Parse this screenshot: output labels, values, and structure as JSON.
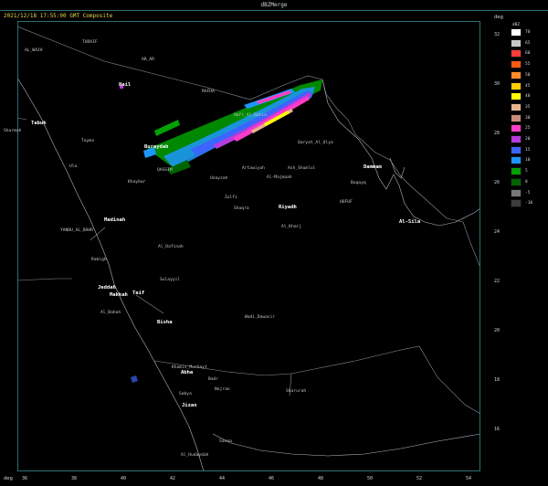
{
  "window": {
    "title": "dBZMerge"
  },
  "product": {
    "timestamp": "2021/12/18 17:55:00 GMT Composite"
  },
  "axis": {
    "corner_label": "deg",
    "right_label": "deg"
  },
  "lat_ticks": [
    "32",
    "30",
    "28",
    "26",
    "24",
    "22",
    "20",
    "18",
    "16"
  ],
  "lon_ticks": [
    "36",
    "38",
    "40",
    "42",
    "44",
    "46",
    "48",
    "50",
    "52",
    "54"
  ],
  "scale": {
    "unit": "dBZ",
    "entries": [
      {
        "label": "70",
        "color": "#ffffff"
      },
      {
        "label": "65",
        "color": "#c8c8c8"
      },
      {
        "label": "60",
        "color": "#ff3c3c"
      },
      {
        "label": "55",
        "color": "#ff5a14"
      },
      {
        "label": "50",
        "color": "#ff8c28"
      },
      {
        "label": "45",
        "color": "#ffcc00"
      },
      {
        "label": "40",
        "color": "#ffff00"
      },
      {
        "label": "35",
        "color": "#e6b48c"
      },
      {
        "label": "30",
        "color": "#c88c78"
      },
      {
        "label": "25",
        "color": "#ff3cc8"
      },
      {
        "label": "20",
        "color": "#b43cdc"
      },
      {
        "label": "15",
        "color": "#3c64ff"
      },
      {
        "label": "10",
        "color": "#1e96ff"
      },
      {
        "label": "5",
        "color": "#00a000"
      },
      {
        "label": "0",
        "color": "#006400"
      },
      {
        "label": "-5",
        "color": "#787878"
      },
      {
        "label": "-10",
        "color": "#3c3c3c"
      }
    ]
  },
  "colors": {
    "frame": "#2e6f74",
    "borders": "#8a949c",
    "timestamp": "#e6d44a"
  },
  "cities": [
    {
      "name": "AL_WAJH",
      "major": false
    },
    {
      "name": "TURAIF",
      "major": false
    },
    {
      "name": "AR_AR",
      "major": false
    },
    {
      "name": "RAFHA",
      "major": false
    },
    {
      "name": "Tabuk",
      "major": true
    },
    {
      "name": "Hail",
      "major": true
    },
    {
      "name": "Buraydah",
      "major": true
    },
    {
      "name": "Unayzah",
      "major": false
    },
    {
      "name": "Al-Majmaah",
      "major": false
    },
    {
      "name": "QASSIM",
      "major": false
    },
    {
      "name": "Artawiyah",
      "major": false
    },
    {
      "name": "Hafr_Al_Batin",
      "major": false
    },
    {
      "name": "Qaryat_Al_Ulya",
      "major": false
    },
    {
      "name": "Ash_Shumlul",
      "major": false
    },
    {
      "name": "Dammam",
      "major": true
    },
    {
      "name": "Buqayq",
      "major": false
    },
    {
      "name": "HOFUF",
      "major": false
    },
    {
      "name": "Sharmah",
      "major": false
    },
    {
      "name": "Tayma",
      "major": false
    },
    {
      "name": "Ula",
      "major": false
    },
    {
      "name": "Khaybar",
      "major": false
    },
    {
      "name": "Zulfi",
      "major": false
    },
    {
      "name": "Shaqra",
      "major": false
    },
    {
      "name": "Riyadh",
      "major": true
    },
    {
      "name": "Al_Kharj",
      "major": false
    },
    {
      "name": "Al-Sila",
      "major": true
    },
    {
      "name": "Madinah",
      "major": true
    },
    {
      "name": "YANBU_AL_BAHR",
      "major": false
    },
    {
      "name": "Rabigh",
      "major": false
    },
    {
      "name": "Jeddah",
      "major": true
    },
    {
      "name": "Makkah",
      "major": true
    },
    {
      "name": "Taif",
      "major": true
    },
    {
      "name": "Al_Bahah",
      "major": false
    },
    {
      "name": "Bisha",
      "major": true
    },
    {
      "name": "Al_Dafinah",
      "major": false
    },
    {
      "name": "Sulayyil",
      "major": false
    },
    {
      "name": "Wadi_Dawasir",
      "major": false
    },
    {
      "name": "Abha",
      "major": true
    },
    {
      "name": "Khamis_Mushayt",
      "major": false
    },
    {
      "name": "Najran",
      "major": false
    },
    {
      "name": "Sharurah",
      "major": false
    },
    {
      "name": "Jizan",
      "major": true
    },
    {
      "name": "Sabya",
      "major": false
    },
    {
      "name": "Al_Hudaydah",
      "major": false
    },
    {
      "name": "Sanaa",
      "major": false
    },
    {
      "name": "Badr",
      "major": false
    }
  ]
}
